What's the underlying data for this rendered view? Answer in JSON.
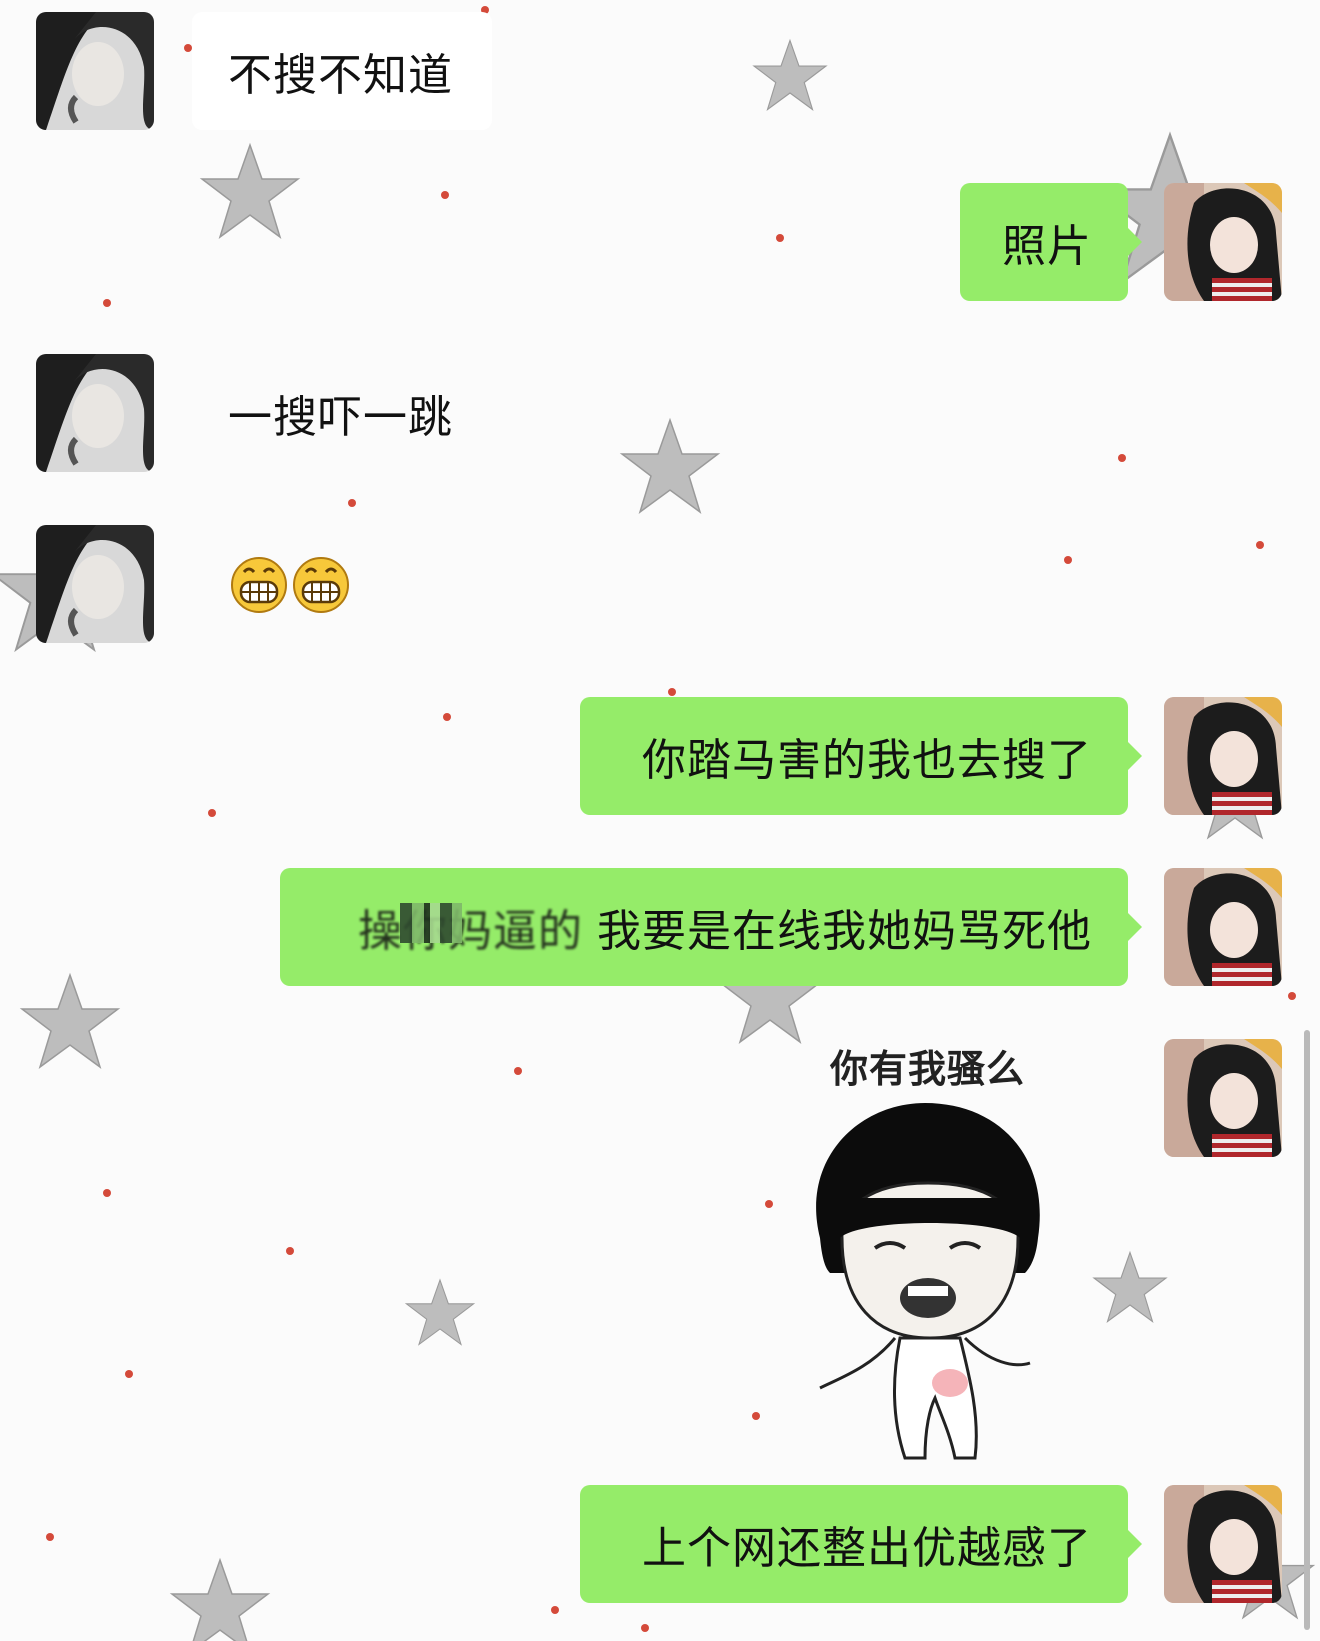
{
  "messages": [
    {
      "side": "in",
      "text": "不搜不知道"
    },
    {
      "side": "out",
      "text": "照片"
    },
    {
      "side": "in",
      "text": "一搜吓一跳"
    },
    {
      "side": "in",
      "emoji": "grin-emoji",
      "emoji_count": 2
    },
    {
      "side": "out",
      "text": "你踏马害的我也去搜了"
    },
    {
      "side": "out",
      "censored_prefix": "操你妈逼的",
      "text": "我要是在线我她妈骂死他"
    },
    {
      "side": "out",
      "sticker_caption": "你有我骚么",
      "sticker": "mushroom-head-meme"
    },
    {
      "side": "out",
      "text": "上个网还整出优越感了"
    }
  ],
  "colors": {
    "outgoing_bubble": "#95ec69",
    "incoming_bubble": "#ffffff",
    "background": "#fbfbfb",
    "star": "#bdbdbd",
    "dot": "#d44a3a"
  }
}
